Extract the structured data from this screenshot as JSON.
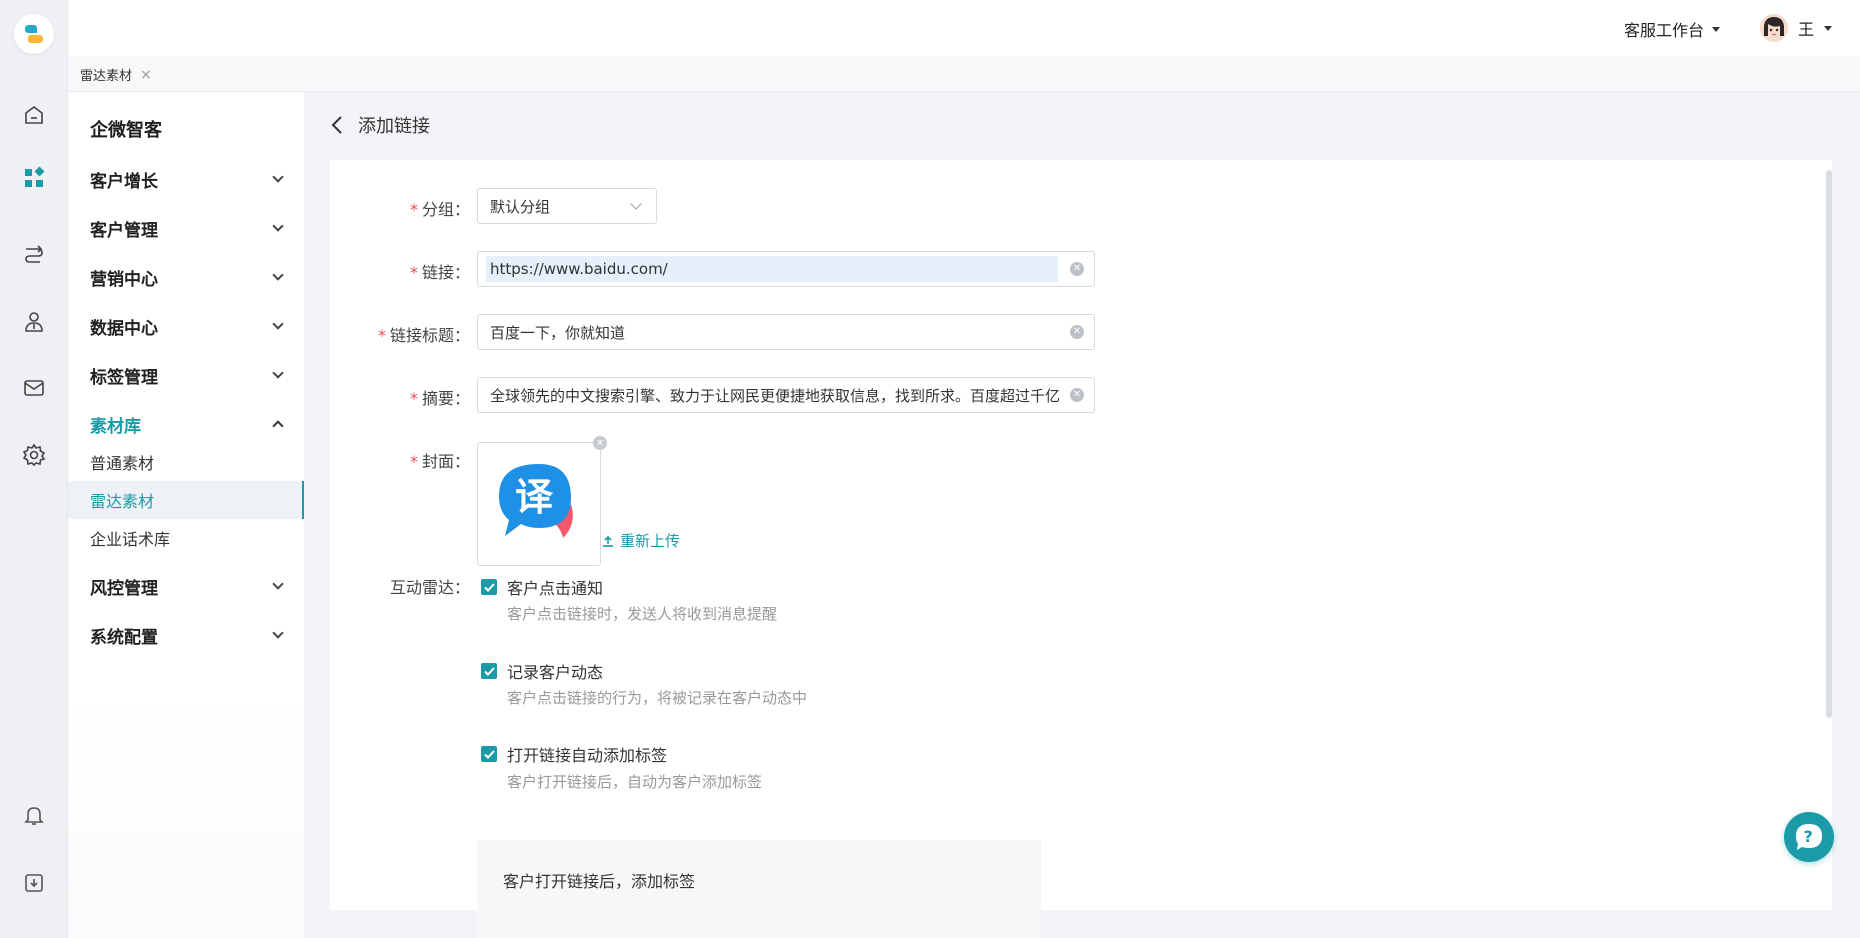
{
  "header": {
    "workbench_label": "客服工作台",
    "user_name": "王"
  },
  "tabs": [
    {
      "label": "雷达素材",
      "close": "×"
    }
  ],
  "subnav": {
    "brand": "企微智客",
    "groups": [
      {
        "label": "客户增长"
      },
      {
        "label": "客户管理"
      },
      {
        "label": "营销中心"
      },
      {
        "label": "数据中心"
      },
      {
        "label": "标签管理"
      },
      {
        "label": "素材库",
        "expanded": true,
        "items": [
          "普通素材",
          "雷达素材",
          "企业话术库"
        ],
        "active_item": "雷达素材"
      },
      {
        "label": "风控管理"
      },
      {
        "label": "系统配置"
      }
    ]
  },
  "page": {
    "title": "添加链接"
  },
  "form": {
    "group": {
      "label": "分组：",
      "value": "默认分组"
    },
    "link": {
      "label": "链接：",
      "value": "https://www.baidu.com/"
    },
    "link_title": {
      "label": "链接标题：",
      "value": "百度一下，你就知道"
    },
    "summary": {
      "label": "摘要：",
      "value": "全球领先的中文搜索引擎、致力于让网民更便捷地获取信息，找到所求。百度超过千亿"
    },
    "cover": {
      "label": "封面：",
      "reupload": "重新上传"
    },
    "radar": {
      "label": "互动雷达：",
      "options": [
        {
          "label": "客户点击通知",
          "hint": "客户点击链接时，发送人将收到消息提醒",
          "checked": true
        },
        {
          "label": "记录客户动态",
          "hint": "客户点击链接的行为，将被记录在客户动态中",
          "checked": true
        },
        {
          "label": "打开链接自动添加标签",
          "hint": "客户打开链接后，自动为客户添加标签",
          "checked": true
        }
      ],
      "tag_box_title": "客户打开链接后，添加标签"
    },
    "required_mark": "*"
  },
  "colors": {
    "accent": "#1a9ba7",
    "required": "#f05050",
    "background": "#f3f4f7"
  },
  "icons": {
    "rail": [
      "home-icon",
      "apps-icon",
      "route-icon",
      "customer-icon",
      "mail-icon",
      "settings-icon",
      "bell-icon",
      "download-icon"
    ]
  }
}
